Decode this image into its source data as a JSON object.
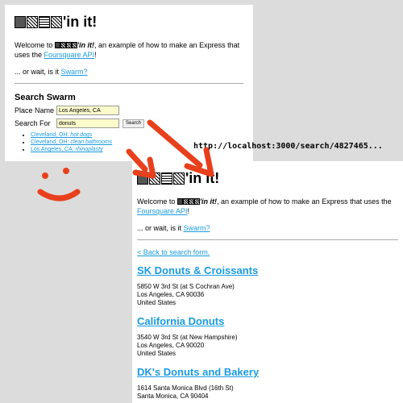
{
  "url": "http://localhost:3000/search/4827465...",
  "site": {
    "title_suffix": "'in it!"
  },
  "search_page": {
    "welcome_prefix": "Welcome to ",
    "welcome_brand_suffix": "'in it!",
    "welcome_middle": ", an example of how to make an Express that uses the ",
    "foursquare_link": "Foursquare API",
    "welcome_end": "!",
    "swarm_prefix": "... or wait, is it ",
    "swarm_link": "Swarm?",
    "heading": "Search Swarm",
    "place_label": "Place Name",
    "place_value": "Los Angeles, CA",
    "search_label": "Search For",
    "search_value": "donuts",
    "search_button": "Search",
    "examples": [
      {
        "place": "Cleveland, OH: ",
        "term": "hot dogs"
      },
      {
        "place": "Cleveland, OH: ",
        "term": "clean bathrooms"
      },
      {
        "place": "Los Angeles, CA: ",
        "term": "rhinoplasty"
      }
    ]
  },
  "results_page": {
    "welcome_prefix": "Welcome to ",
    "welcome_brand_suffix": "'in it!",
    "welcome_middle": ", an example of how to make an Express that uses the ",
    "foursquare_link": "Foursquare API",
    "welcome_end": "!",
    "swarm_prefix": "... or wait, is it ",
    "swarm_link": "Swarm?",
    "back_link": "< Back to search form.",
    "venues": [
      {
        "name": "SK Donuts & Croissants",
        "line1": "5850 W 3rd St (at S Cochran Ave)",
        "line2": "Los Angeles, CA 90036",
        "line3": "United States"
      },
      {
        "name": "California Donuts",
        "line1": "3540 W 3rd St (at New Hampshire)",
        "line2": "Los Angeles, CA 90020",
        "line3": "United States"
      },
      {
        "name": "DK's Donuts and Bakery",
        "line1": "1614 Santa Monica Blvd (16th St)",
        "line2": "Santa Monica, CA 90404",
        "line3": ""
      }
    ]
  },
  "colors": {
    "link": "#1a9be0",
    "annotation": "#e8401c",
    "input_bg": "#fbfbcc",
    "backdrop": "#dcdcdc"
  }
}
